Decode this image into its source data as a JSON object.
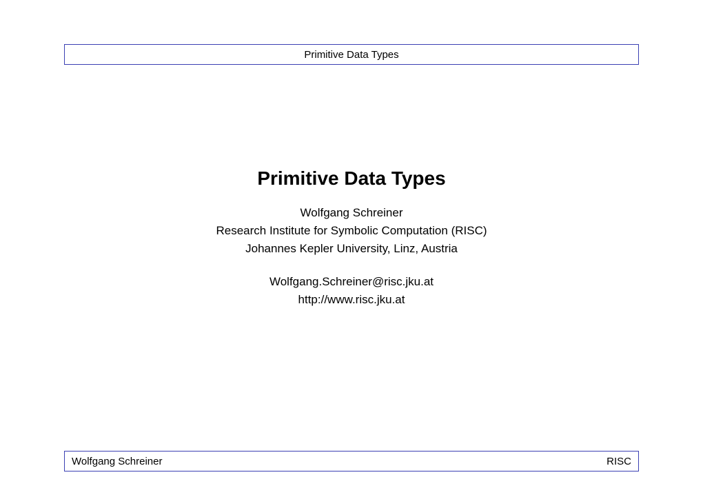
{
  "header": {
    "title": "Primitive Data Types"
  },
  "main": {
    "title": "Primitive Data Types",
    "author": "Wolfgang Schreiner",
    "affiliation1": "Research Institute for Symbolic Computation (RISC)",
    "affiliation2": "Johannes Kepler University, Linz, Austria",
    "email": "Wolfgang.Schreiner@risc.jku.at",
    "url": "http://www.risc.jku.at"
  },
  "footer": {
    "left": "Wolfgang Schreiner",
    "right": "RISC"
  }
}
